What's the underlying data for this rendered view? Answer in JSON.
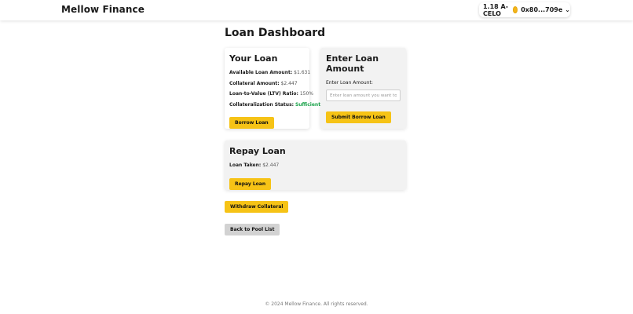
{
  "header": {
    "brand": "Mellow Finance",
    "balance": "1.18 A-CELO",
    "address": "0x80...709e",
    "chevron": "⌄"
  },
  "page_title": "Loan Dashboard",
  "your_loan": {
    "title": "Your Loan",
    "available_label": "Available Loan Amount:",
    "available_value": "$1.631",
    "collateral_label": "Collateral Amount:",
    "collateral_value": "$2.447",
    "ltv_label": "Loan-to-Value (LTV) Ratio:",
    "ltv_value": "150%",
    "status_label": "Collateralization Status:",
    "status_value": "Sufficient",
    "button": "Borrow Loan"
  },
  "enter_loan": {
    "title": "Enter Loan Amount",
    "label": "Enter Loan Amount:",
    "placeholder": "Enter loan amount you want to",
    "button": "Submit Borrow Loan"
  },
  "repay_loan": {
    "title": "Repay Loan",
    "taken_label": "Loan Taken:",
    "taken_value": "$2.447",
    "button": "Repay Loan"
  },
  "withdraw_button": "Withdraw Collateral",
  "back_button": "Back to Pool List",
  "footer": "© 2024 Mellow Finance. All rights reserved.",
  "colors": {
    "accent_yellow": "#f6c316",
    "status_green": "#1aa34a",
    "card_gray": "#f2f2f2"
  }
}
